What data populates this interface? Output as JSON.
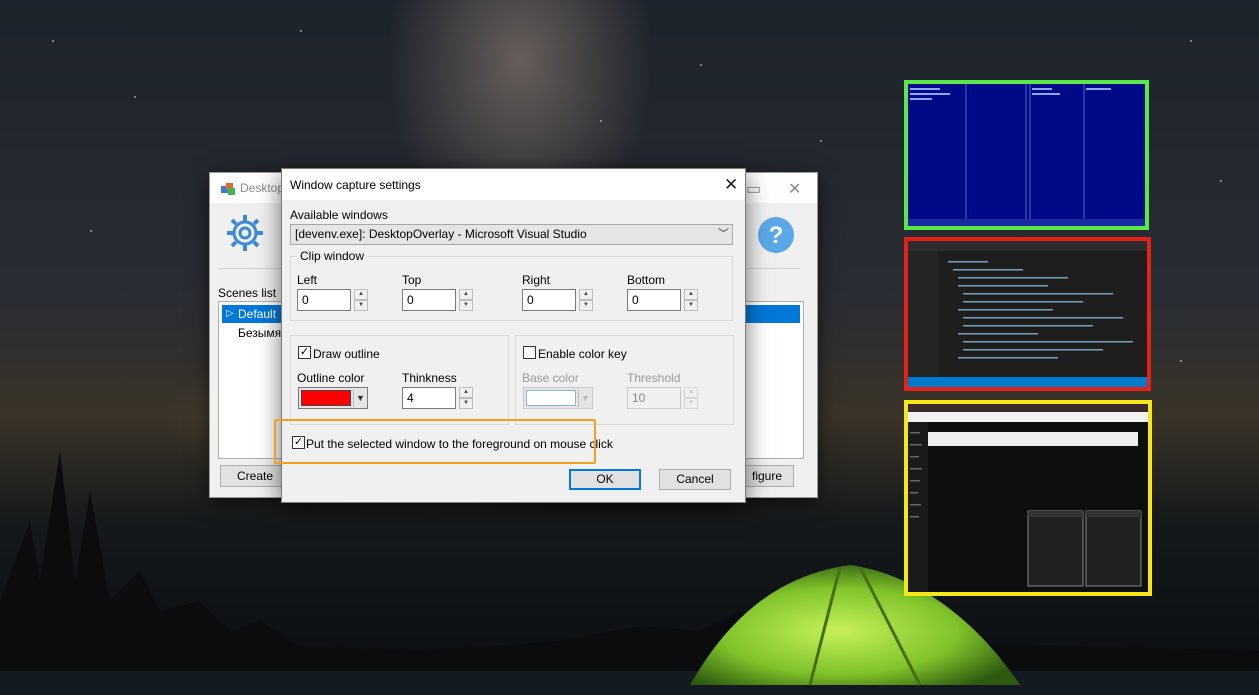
{
  "main_window": {
    "title": "Desktop",
    "scenes_label": "Scenes list",
    "scenes": [
      {
        "label": "Default",
        "selected": true
      },
      {
        "label": "Безымян",
        "selected": false
      }
    ],
    "create_button": "Create",
    "configure_button": "figure"
  },
  "dialog": {
    "title": "Window capture settings",
    "available_windows_label": "Available windows",
    "selected_window": "[devenv.exe]: DesktopOverlay - Microsoft Visual Studio",
    "clip_group": {
      "title": "Clip window",
      "left_label": "Left",
      "left_value": "0",
      "top_label": "Top",
      "top_value": "0",
      "right_label": "Right",
      "right_value": "0",
      "bottom_label": "Bottom",
      "bottom_value": "0"
    },
    "outline": {
      "checkbox_label": "Draw outline",
      "checked": true,
      "color_label": "Outline color",
      "color": "#ff0000",
      "thickness_label": "Thinkness",
      "thickness_value": "4"
    },
    "color_key": {
      "checkbox_label": "Enable color key",
      "checked": false,
      "base_color_label": "Base color",
      "threshold_label": "Threshold",
      "threshold_value": "10"
    },
    "foreground_checkbox_label": "Put the selected window to the foreground on mouse click",
    "foreground_checked": true,
    "ok_button": "OK",
    "cancel_button": "Cancel"
  },
  "colors": {
    "highlight": "#f0a020",
    "thumb_vs_border": "#5ce84a",
    "thumb_code_border": "#e52218",
    "thumb_web_border": "#f4e81a",
    "selection": "#0078d7"
  }
}
